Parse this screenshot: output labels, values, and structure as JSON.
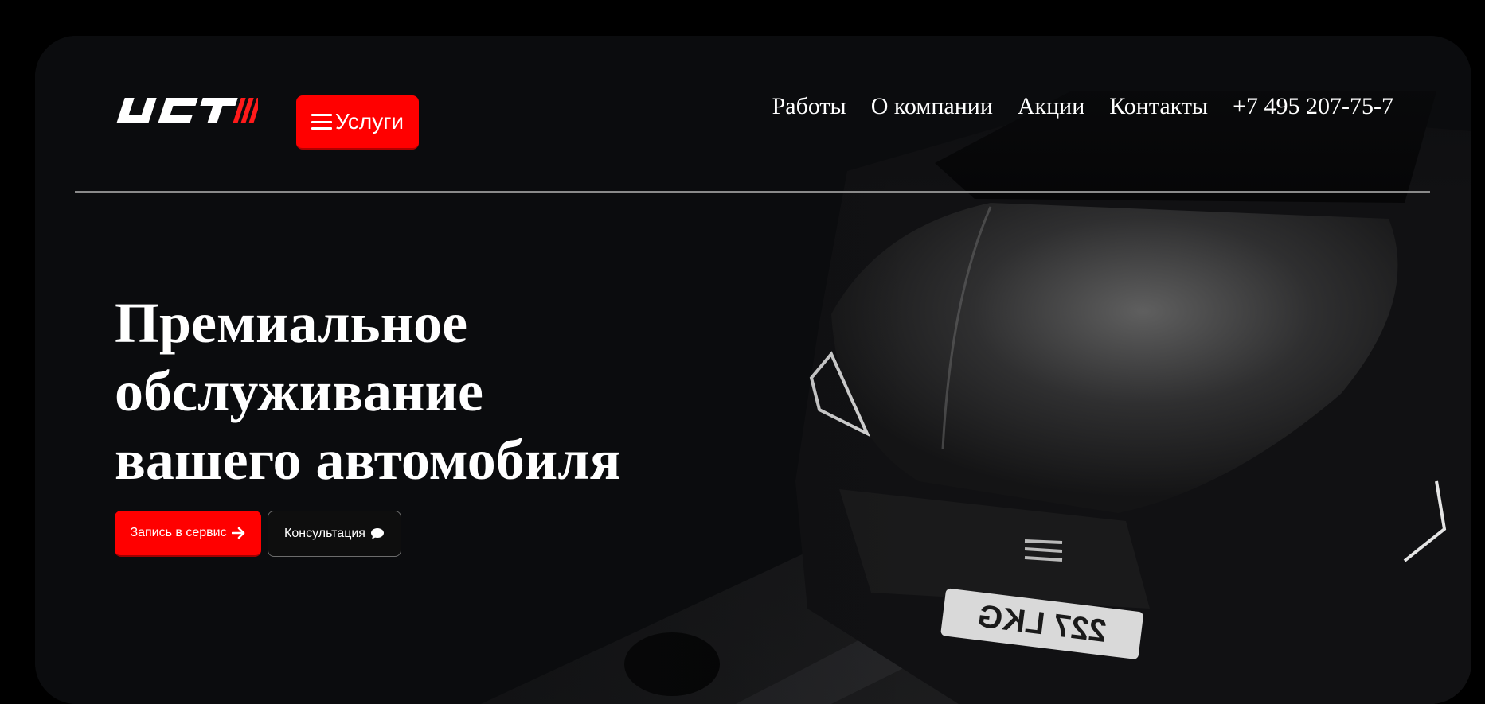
{
  "header": {
    "logo_text": "UCT",
    "services_label": "Услуги",
    "nav": [
      {
        "label": "Работы"
      },
      {
        "label": "О компании"
      },
      {
        "label": "Акции"
      },
      {
        "label": "Контакты"
      }
    ],
    "phone": "+7 495 207-75-7"
  },
  "hero": {
    "headline_lines": [
      "Премиальное",
      "обслуживание",
      "вашего автомобиля"
    ],
    "primary_cta": "Запись в сервис",
    "secondary_cta": "Консультация",
    "plate_text": "227 LKG"
  },
  "colors": {
    "accent": "#ff0000",
    "background": "#000000",
    "panel": "#0b0c0e",
    "text": "#ffffff",
    "divider": "#8a8a8a"
  },
  "icons": {
    "services": "burger-menu-icon",
    "primary_cta": "arrow-right-icon",
    "secondary_cta": "chat-bubble-icon"
  }
}
